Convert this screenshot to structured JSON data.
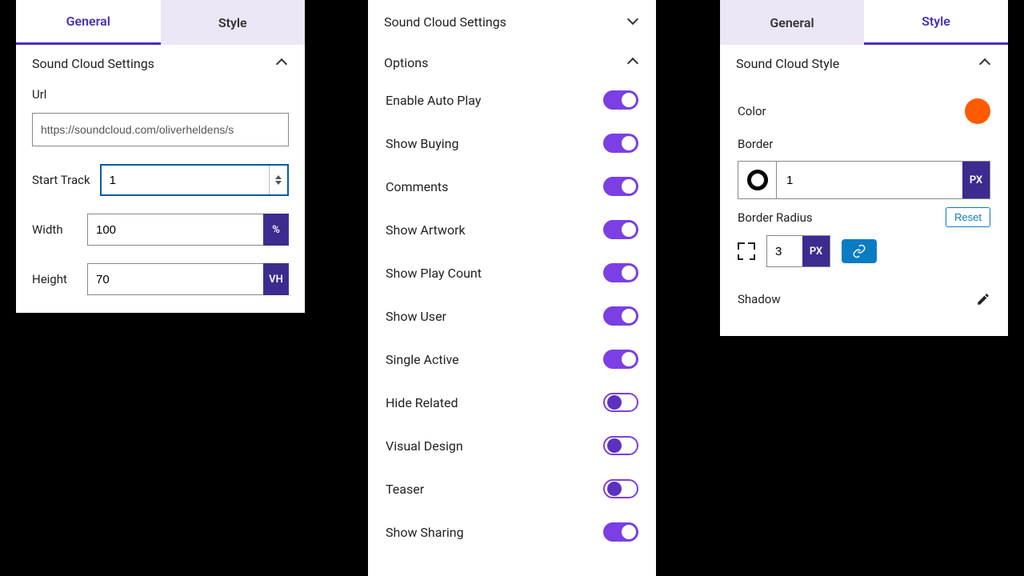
{
  "panel1": {
    "tabs": {
      "general": "General",
      "style": "Style",
      "active": "general"
    },
    "sections": {
      "settings": {
        "title": "Sound Cloud Settings",
        "open": true
      }
    },
    "url": {
      "label": "Url",
      "value": "https://soundcloud.com/oliverheldens/s"
    },
    "start_track": {
      "label": "Start Track",
      "value": "1"
    },
    "width": {
      "label": "Width",
      "value": "100",
      "unit": "%"
    },
    "height": {
      "label": "Height",
      "value": "70",
      "unit": "VH"
    }
  },
  "panel2": {
    "sections": {
      "settings": {
        "title": "Sound Cloud Settings",
        "open": false
      },
      "options": {
        "title": "Options",
        "open": true
      }
    },
    "options": [
      {
        "label": "Enable Auto Play",
        "on": true
      },
      {
        "label": "Show Buying",
        "on": true
      },
      {
        "label": "Comments",
        "on": true
      },
      {
        "label": "Show Artwork",
        "on": true
      },
      {
        "label": "Show Play Count",
        "on": true
      },
      {
        "label": "Show User",
        "on": true
      },
      {
        "label": "Single Active",
        "on": true
      },
      {
        "label": "Hide Related",
        "on": false
      },
      {
        "label": "Visual Design",
        "on": false
      },
      {
        "label": "Teaser",
        "on": false
      },
      {
        "label": "Show Sharing",
        "on": true
      }
    ]
  },
  "panel3": {
    "tabs": {
      "general": "General",
      "style": "Style",
      "active": "style"
    },
    "sections": {
      "style": {
        "title": "Sound Cloud Style",
        "open": true
      }
    },
    "color": {
      "label": "Color",
      "value": "#ff5a00"
    },
    "border": {
      "label": "Border",
      "value": "1",
      "unit": "PX"
    },
    "radius": {
      "label": "Border Radius",
      "value": "3",
      "unit": "PX",
      "reset_label": "Reset"
    },
    "shadow": {
      "label": "Shadow"
    }
  }
}
